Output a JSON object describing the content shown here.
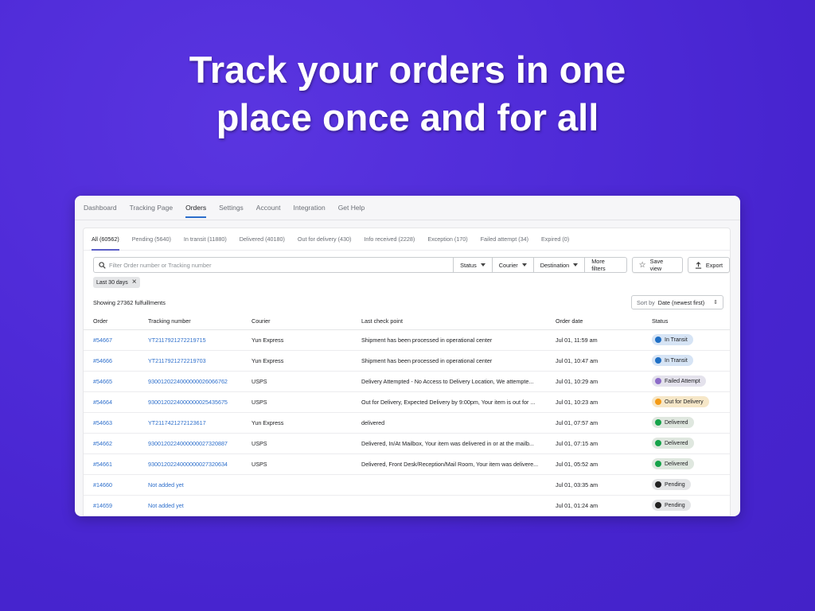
{
  "headline": {
    "line1": "Track your orders in one",
    "line2": "place once and for all"
  },
  "topnav": [
    {
      "label": "Dashboard",
      "active": false
    },
    {
      "label": "Tracking Page",
      "active": false
    },
    {
      "label": "Orders",
      "active": true
    },
    {
      "label": "Settings",
      "active": false
    },
    {
      "label": "Account",
      "active": false
    },
    {
      "label": "Integration",
      "active": false
    },
    {
      "label": "Get Help",
      "active": false
    }
  ],
  "tabs": [
    {
      "label": "All (60562)",
      "active": true
    },
    {
      "label": "Pending (5640)",
      "active": false
    },
    {
      "label": "In transit (11880)",
      "active": false
    },
    {
      "label": "Delivered (40180)",
      "active": false
    },
    {
      "label": "Out for delivery (430)",
      "active": false
    },
    {
      "label": "Info received (2228)",
      "active": false
    },
    {
      "label": "Exception (170)",
      "active": false
    },
    {
      "label": "Failed attempt (34)",
      "active": false
    },
    {
      "label": "Expired (0)",
      "active": false
    }
  ],
  "filters": {
    "search_placeholder": "Filter Order number or Tracking number",
    "status": "Status",
    "courier": "Courier",
    "destination": "Destination",
    "more": "More filters",
    "save_view": "Save view",
    "export": "Export"
  },
  "chip": {
    "label": "Last 30 days"
  },
  "showing": "Showing 27362 fulfuillments",
  "sort": {
    "label": "Sort by",
    "value": "Date (newest first)"
  },
  "columns": [
    "Order",
    "Tracking number",
    "Courier",
    "Last check point",
    "Order date",
    "Status"
  ],
  "rows": [
    {
      "order": "#54667",
      "tracking": "YT2117921272219715",
      "courier": "Yun Express",
      "checkpoint": "Shipment has been processed in operational center",
      "date": "Jul 01, 11:59 am",
      "status": "In Transit",
      "status_bg": "#d6e4f5",
      "dot": "#1f6fc5"
    },
    {
      "order": "#54666",
      "tracking": "YT2117921272219703",
      "courier": "Yun Express",
      "checkpoint": "Shipment has been processed in operational center",
      "date": "Jul 01, 10:47 am",
      "status": "In Transit",
      "status_bg": "#d6e4f5",
      "dot": "#1f6fc5"
    },
    {
      "order": "#54665",
      "tracking": "9300120224000000026066762",
      "courier": "USPS",
      "checkpoint": "Delivery Attempted - No Access to Delivery Location, We attempte...",
      "date": "Jul 01, 10:29 am",
      "status": "Failed Attempt",
      "status_bg": "#e4e2ec",
      "dot": "#8c6bc8"
    },
    {
      "order": "#54664",
      "tracking": "9300120224000000025435675",
      "courier": "USPS",
      "checkpoint": "Out for Delivery, Expected Delivery by 9:00pm, Your item is out for ...",
      "date": "Jul 01, 10:23 am",
      "status": "Out for Delivery",
      "status_bg": "#f6e7c8",
      "dot": "#f49a14"
    },
    {
      "order": "#54663",
      "tracking": "YT2117421272123617",
      "courier": "Yun Express",
      "checkpoint": "delivered",
      "date": "Jul 01, 07:57 am",
      "status": "Delivered",
      "status_bg": "#dfe7df",
      "dot": "#16a34a"
    },
    {
      "order": "#54662",
      "tracking": "9300120224000000027320887",
      "courier": "USPS",
      "checkpoint": "Delivered, In/At Mailbox, Your item was delivered in or at the mailb...",
      "date": "Jul 01, 07:15 am",
      "status": "Delivered",
      "status_bg": "#dfe7df",
      "dot": "#16a34a"
    },
    {
      "order": "#54661",
      "tracking": "9300120224000000027320634",
      "courier": "USPS",
      "checkpoint": "Delivered, Front Desk/Reception/Mail Room, Your item was delivere...",
      "date": "Jul 01, 05:52 am",
      "status": "Delivered",
      "status_bg": "#dfe7df",
      "dot": "#16a34a"
    },
    {
      "order": "#14660",
      "tracking": "Not added yet",
      "courier": "",
      "checkpoint": "",
      "date": "Jul 01, 03:35 am",
      "status": "Pending",
      "status_bg": "#e4e5e7",
      "dot": "#222222"
    },
    {
      "order": "#14659",
      "tracking": "Not added yet",
      "courier": "",
      "checkpoint": "",
      "date": "Jul 01, 01:24 am",
      "status": "Pending",
      "status_bg": "#e4e5e7",
      "dot": "#222222"
    }
  ]
}
